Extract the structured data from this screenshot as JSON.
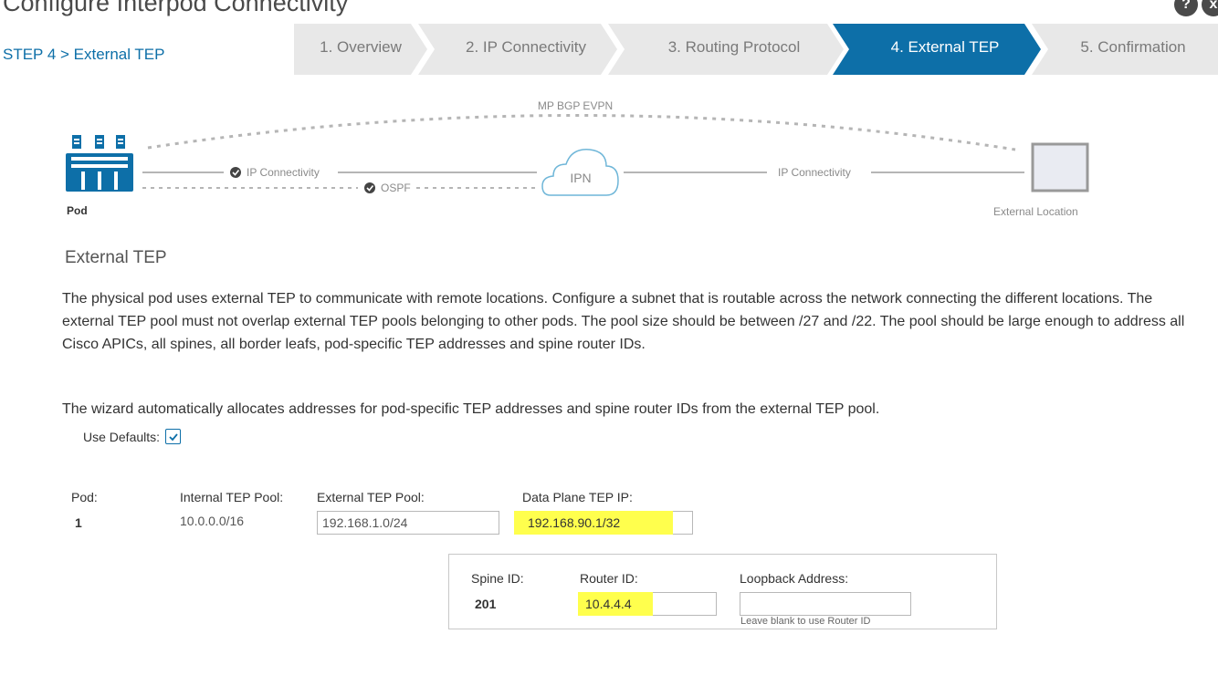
{
  "window": {
    "title": "Configure Interpod Connectivity"
  },
  "header": {
    "step_label": "STEP 4 > External TEP",
    "help_icon_glyph": "?",
    "close_icon_glyph": "x"
  },
  "wizard": {
    "steps": [
      {
        "label": "1. Overview",
        "active": false
      },
      {
        "label": "2. IP Connectivity",
        "active": false
      },
      {
        "label": "3. Routing Protocol",
        "active": false
      },
      {
        "label": "4. External TEP",
        "active": true
      },
      {
        "label": "5. Confirmation",
        "active": false
      }
    ],
    "active_color": "#0d6fa8",
    "inactive_color": "#e8e8e8"
  },
  "diagram": {
    "bgp_label": "MP BGP EVPN",
    "left_link_label": "IP Connectivity",
    "ospf_label": "OSPF",
    "cloud_label": "IPN",
    "right_link_label": "IP Connectivity",
    "pod_label": "Pod",
    "external_label": "External Location"
  },
  "section": {
    "title": "External TEP",
    "description": "The physical pod uses external TEP to communicate with remote locations. Configure a subnet that is routable across the network connecting the different locations. The external TEP pool must not overlap external TEP pools belonging to other pods. The pool size should be between /27 and /22. The pool should be large enough to address all Cisco APICs, all spines, all border leafs, pod-specific TEP addresses and spine router IDs.",
    "auto_note": "The wizard automatically allocates addresses for pod-specific TEP addresses and spine router IDs from the external TEP pool.",
    "use_defaults_label": "Use Defaults:",
    "use_defaults_checked": true
  },
  "pod_table": {
    "headers": {
      "pod": "Pod:",
      "internal_pool": "Internal TEP Pool:",
      "external_pool": "External TEP Pool:",
      "data_plane_ip": "Data Plane TEP IP:"
    },
    "row": {
      "pod": "1",
      "internal_pool": "10.0.0.0/16",
      "external_pool": "192.168.1.0/24",
      "data_plane_ip": "192.168.90.1/32"
    }
  },
  "spine_table": {
    "headers": {
      "spine_id": "Spine ID:",
      "router_id": "Router ID:",
      "loopback": "Loopback Address:"
    },
    "row": {
      "spine_id": "201",
      "router_id": "10.4.4.4",
      "loopback": "",
      "loopback_hint": "Leave blank to use Router ID"
    }
  },
  "highlight_color": "#ffff4d"
}
